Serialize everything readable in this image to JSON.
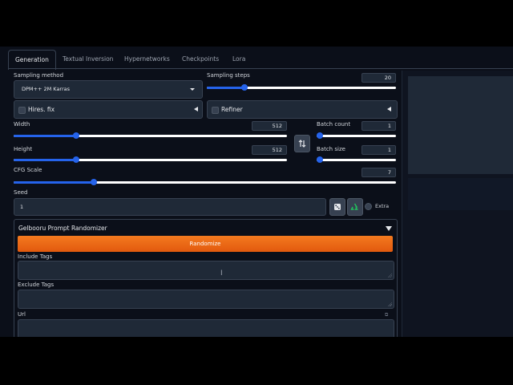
{
  "tabs": [
    {
      "label": "Generation",
      "active": true
    },
    {
      "label": "Textual Inversion",
      "active": false
    },
    {
      "label": "Hypernetworks",
      "active": false
    },
    {
      "label": "Checkpoints",
      "active": false
    },
    {
      "label": "Lora",
      "active": false
    }
  ],
  "sampling": {
    "method_label": "Sampling method",
    "method_value": "DPM++ 2M Karras",
    "steps_label": "Sampling steps",
    "steps_value": "20",
    "steps_fraction": 0.2
  },
  "hires": {
    "label": "Hires. fix"
  },
  "refiner": {
    "label": "Refiner"
  },
  "size": {
    "width_label": "Width",
    "width_value": "512",
    "width_fraction": 0.23,
    "height_label": "Height",
    "height_value": "512",
    "height_fraction": 0.23,
    "swap_icon": "swap-icon"
  },
  "batch": {
    "count_label": "Batch count",
    "count_value": "1",
    "count_fraction": 0.0,
    "size_label": "Batch size",
    "size_value": "1",
    "size_fraction": 0.0
  },
  "cfg": {
    "label": "CFG Scale",
    "value": "7",
    "fraction": 0.21
  },
  "seed": {
    "label": "Seed",
    "value": "1",
    "extra_label": "Extra",
    "dice_icon": "dice-icon",
    "recycle_icon": "recycle-icon"
  },
  "randomizer": {
    "title": "Gelbooru Prompt Randomizer",
    "button_label": "Randomize",
    "include_label": "Include Tags",
    "exclude_label": "Exclude Tags",
    "url_label": "Url"
  },
  "colors": {
    "accent": "#2563eb",
    "orange": "#e8620f",
    "background": "#0b0f19",
    "panel": "#1f2937"
  }
}
